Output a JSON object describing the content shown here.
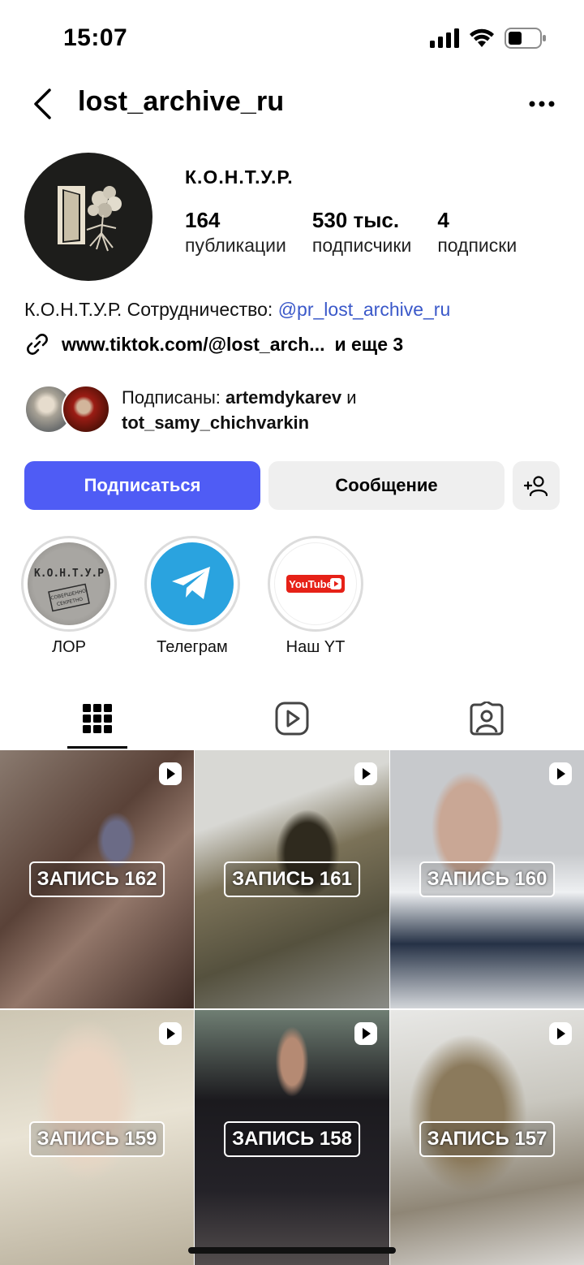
{
  "status_bar": {
    "time": "15:07"
  },
  "header": {
    "username": "lost_archive_ru"
  },
  "profile": {
    "display_name": "К.О.Н.Т.У.Р.",
    "stats": [
      {
        "value": "164",
        "label": "публикации"
      },
      {
        "value": "530 тыс.",
        "label": "подписчики"
      },
      {
        "value": "4",
        "label": "подписки"
      }
    ],
    "bio_text": "К.О.Н.Т.У.Р. Сотрудничество: ",
    "bio_mention": "@pr_lost_archive_ru",
    "link_text": "www.tiktok.com/@lost_arch...",
    "link_more": "и еще 3",
    "followed_by_prefix": "Подписаны: ",
    "followed_by_user1": "artemdykarev",
    "followed_by_and": " и",
    "followed_by_user2": "tot_samy_chichvarkin"
  },
  "buttons": {
    "follow": "Подписаться",
    "message": "Сообщение"
  },
  "highlights": [
    {
      "label": "ЛОР",
      "art_text": "К.О.Н.Т.У.Р",
      "stamp": "СОВЕРШЕННО СЕКРЕТНО"
    },
    {
      "label": "Телеграм"
    },
    {
      "label": "Наш YT",
      "art_text": "YouTube"
    }
  ],
  "tabs": [
    "grid",
    "reels",
    "tagged"
  ],
  "posts": [
    {
      "title": "ЗАПИСЬ 162"
    },
    {
      "title": "ЗАПИСЬ 161"
    },
    {
      "title": "ЗАПИСЬ 160"
    },
    {
      "title": "ЗАПИСЬ 159"
    },
    {
      "title": "ЗАПИСЬ 158"
    },
    {
      "title": "ЗАПИСЬ 157"
    }
  ],
  "colors": {
    "accent": "#4f5cf5",
    "mention": "#3a58c9",
    "telegram": "#2aa3df"
  }
}
